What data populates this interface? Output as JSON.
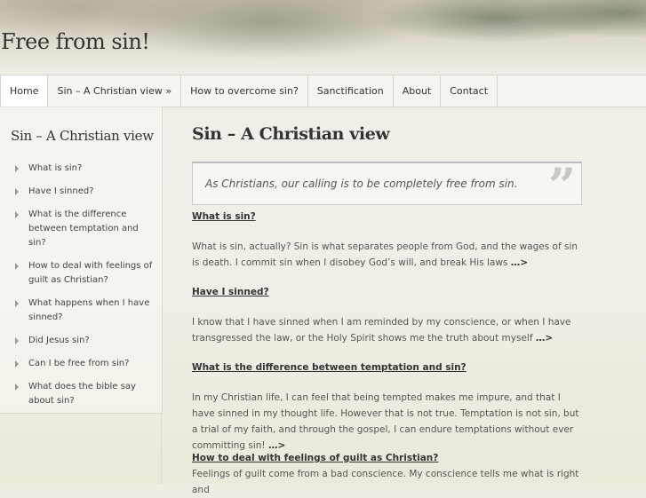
{
  "site": {
    "title": "Free from sin!"
  },
  "nav": {
    "items": [
      {
        "label": "Home"
      },
      {
        "label": "Sin – A Christian view »"
      },
      {
        "label": "How to overcome sin?"
      },
      {
        "label": "Sanctification"
      },
      {
        "label": "About"
      },
      {
        "label": "Contact"
      }
    ]
  },
  "sidebar": {
    "title": "Sin – A Christian view",
    "items": [
      {
        "label": "What is sin?"
      },
      {
        "label": "Have I sinned?"
      },
      {
        "label": "What is the difference between temptation and sin?"
      },
      {
        "label": "How to deal with feelings of guilt as Christian?"
      },
      {
        "label": "What happens when I have sinned?"
      },
      {
        "label": "Did Jesus sin?"
      },
      {
        "label": "Can I be free from sin?"
      },
      {
        "label": "What does the bible say about sin?"
      }
    ]
  },
  "main": {
    "title": "Sin – A Christian view",
    "quote": "As Christians, our calling is to be completely free from sin.",
    "quote_mark": "”",
    "more": "…>",
    "sections": [
      {
        "heading": "What is sin?",
        "body": "What is sin, actually? Sin is what separates people from God, and the wages of sin is death. I commit sin when I disobey God’s will, and break His laws"
      },
      {
        "heading": "Have I sinned?",
        "body": "I know that I have sinned when I am reminded by my conscience, or when I have transgressed the law, or the Holy Spirit shows me the truth about myself"
      },
      {
        "heading": "What is the difference between temptation and sin?",
        "body": "In my Christian life, I can feel that being tempted makes me impure, and that I have sinned in my thought life. However that is not true. Temptation is not sin, but a trial of my faith, and through the gospel, I can endure temptations without ever committing sin!"
      },
      {
        "heading": "How to deal with feelings of guilt as Christian?",
        "body": "Feelings of guilt come from a bad conscience. My conscience tells me what is right and"
      }
    ]
  }
}
